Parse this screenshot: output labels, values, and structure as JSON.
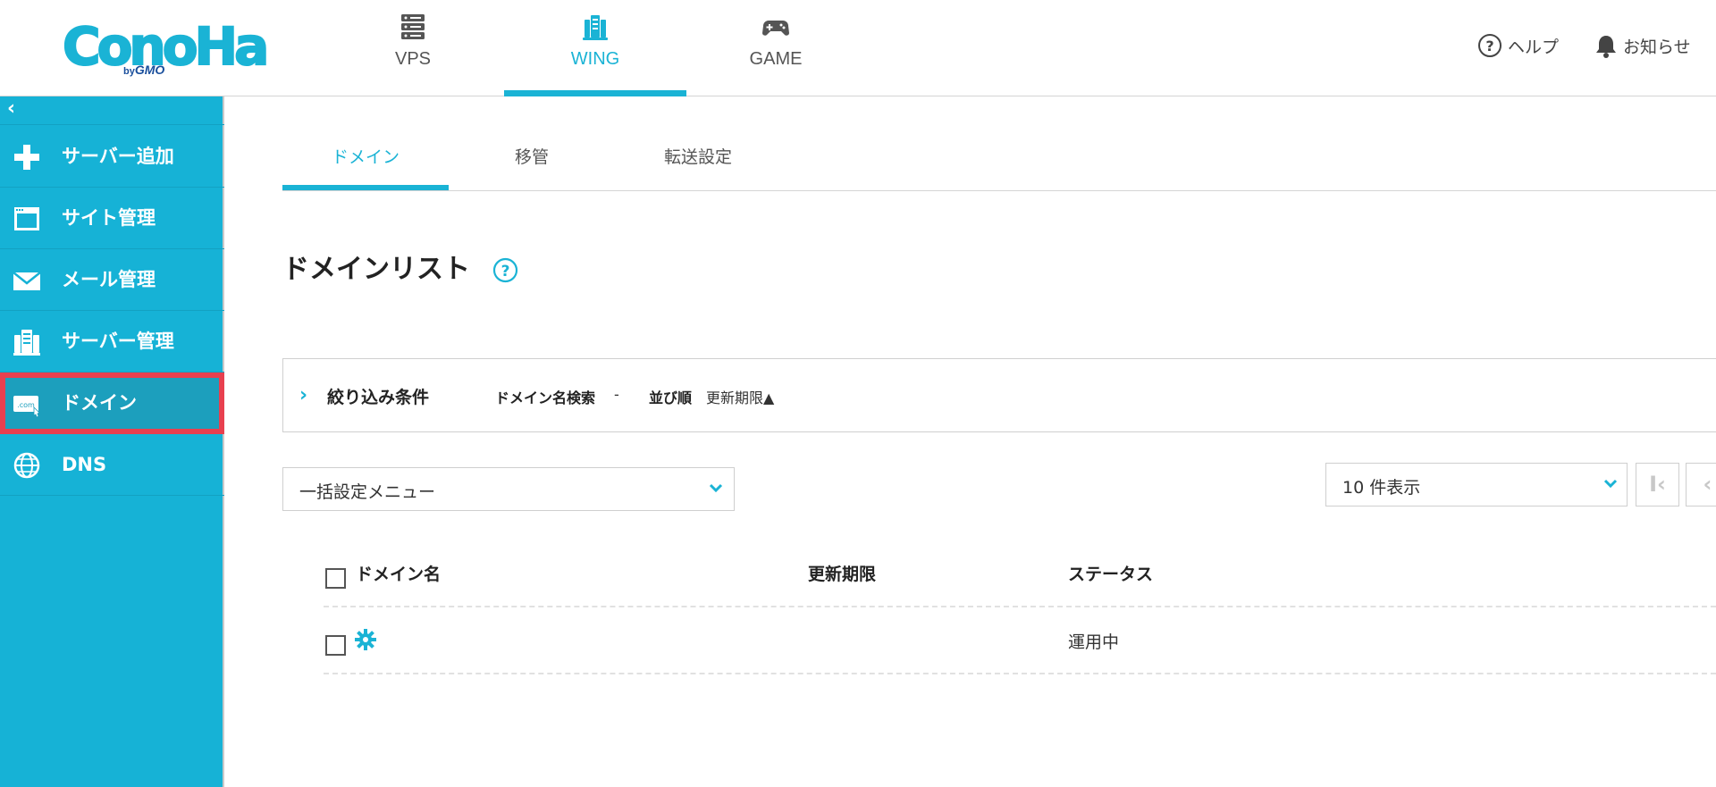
{
  "brand": {
    "logo_text": "ConoHa",
    "logo_sub_prefix": "by",
    "logo_sub_brand": "GMO",
    "accent": "#1ab3d5",
    "sidebar_bg": "#16b2d6",
    "highlight": "#e8404f"
  },
  "header": {
    "tabs": [
      {
        "label": "VPS",
        "icon": "server-icon",
        "active": false
      },
      {
        "label": "WING",
        "icon": "wing-icon",
        "active": true
      },
      {
        "label": "GAME",
        "icon": "gamepad-icon",
        "active": false
      }
    ],
    "help_label": "ヘルプ",
    "notice_label": "お知らせ"
  },
  "sidebar": {
    "collapse_icon": "‹",
    "items": [
      {
        "label": "サーバー追加",
        "icon": "plus-icon"
      },
      {
        "label": "サイト管理",
        "icon": "window-icon"
      },
      {
        "label": "メール管理",
        "icon": "mail-icon"
      },
      {
        "label": "サーバー管理",
        "icon": "server-manage-icon"
      },
      {
        "label": "ドメイン",
        "icon": "domain-com-icon",
        "active": true
      },
      {
        "label": "DNS",
        "icon": "globe-icon"
      }
    ]
  },
  "subtabs": [
    {
      "label": "ドメイン",
      "active": true
    },
    {
      "label": "移管",
      "active": false
    },
    {
      "label": "転送設定",
      "active": false
    }
  ],
  "page": {
    "title": "ドメインリスト"
  },
  "filter": {
    "title": "絞り込み条件",
    "search_key": "ドメイン名検索",
    "search_value": "-",
    "sort_key": "並び順",
    "sort_value": "更新期限▲"
  },
  "bulk_menu": {
    "selected": "一括設定メニュー"
  },
  "per_page": {
    "selected": "10 件表示"
  },
  "pagination": {
    "first_label": "I‹",
    "prev_label": "‹"
  },
  "table": {
    "columns": [
      "ドメイン名",
      "更新期限",
      "ステータス"
    ],
    "rows": [
      {
        "domain": "",
        "expiry": "",
        "status": "運用中"
      }
    ]
  }
}
